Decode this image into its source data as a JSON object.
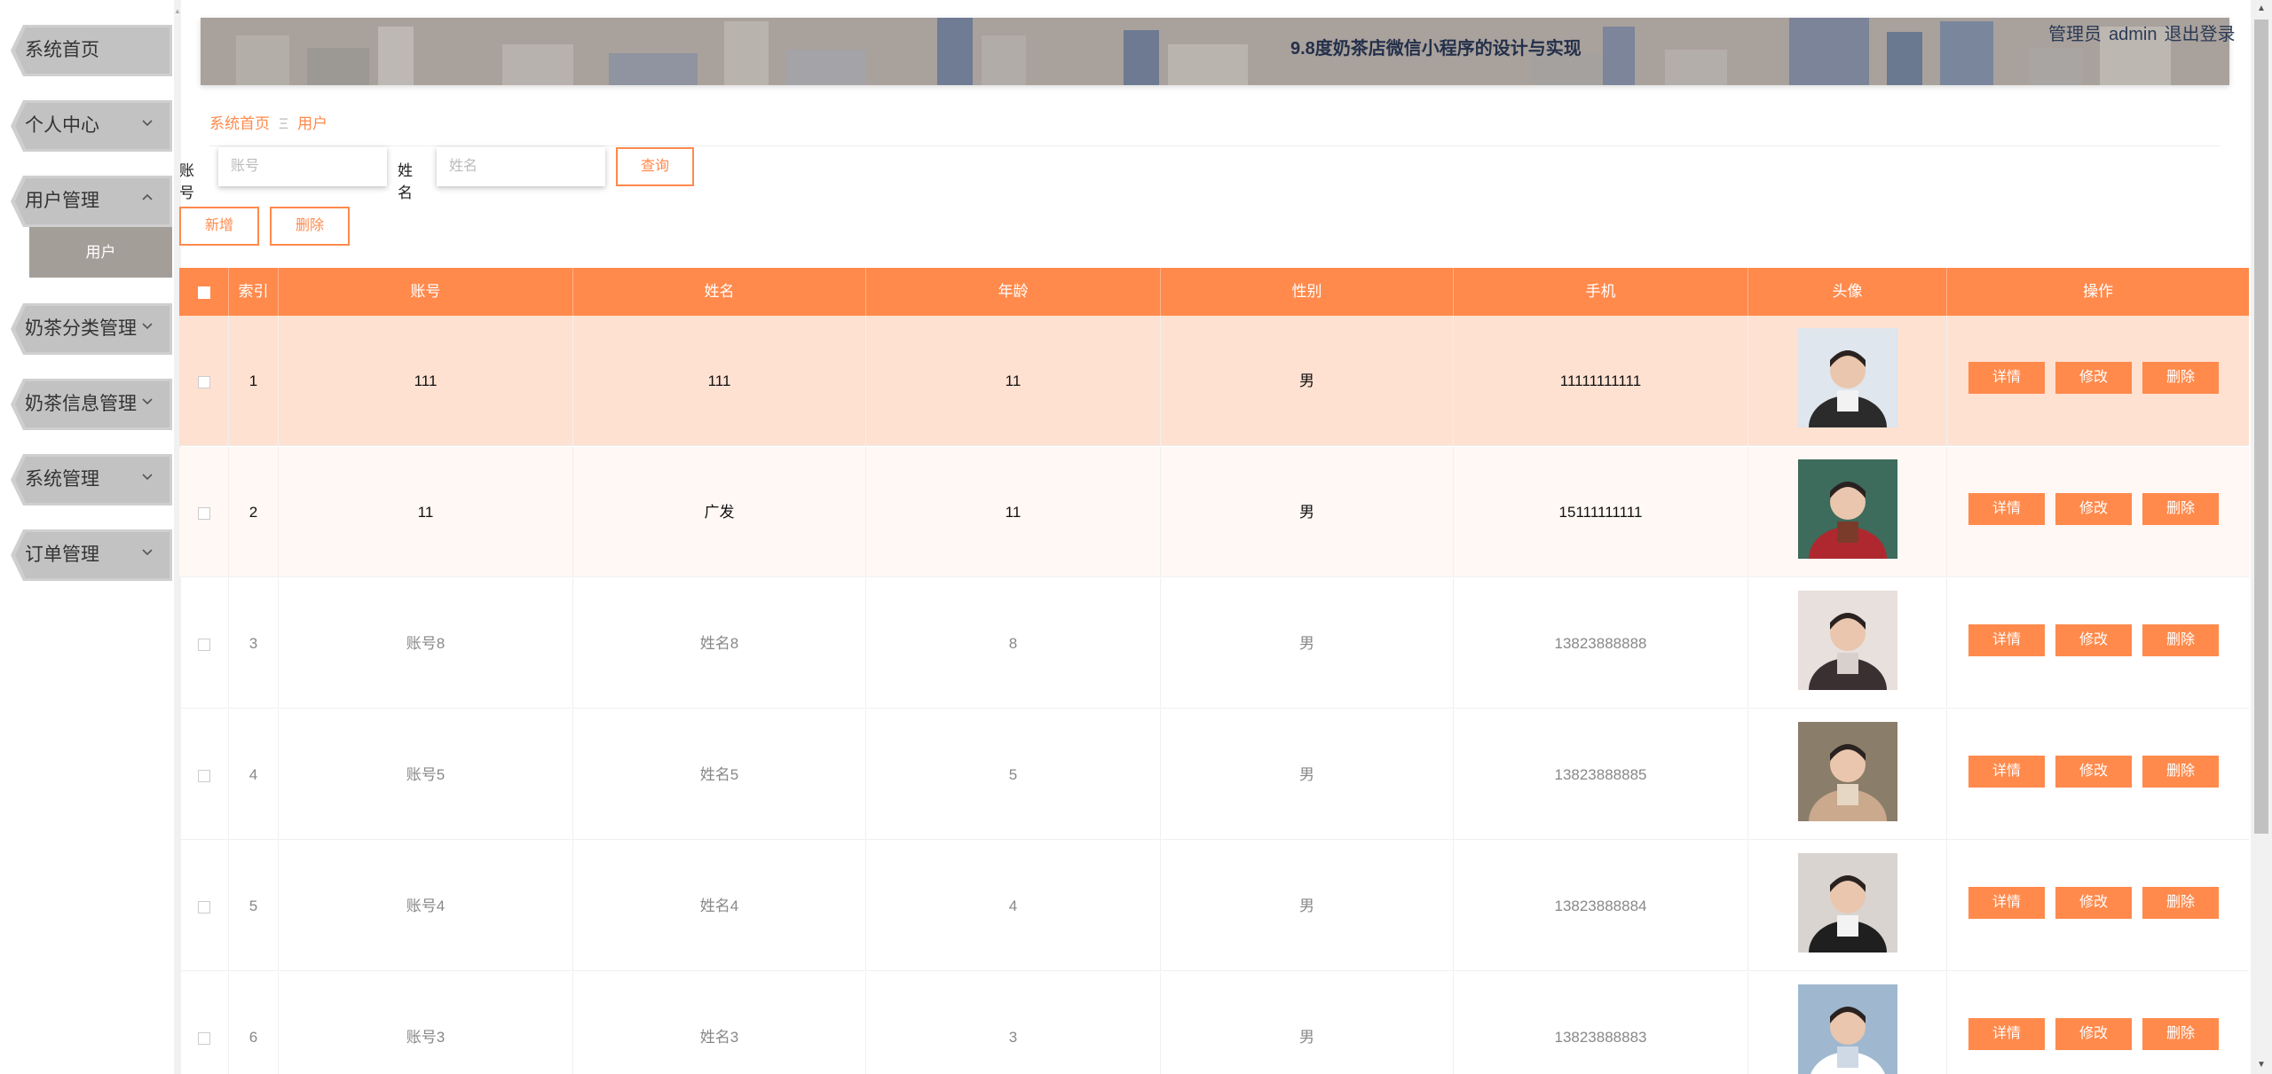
{
  "header": {
    "title": "9.8度奶茶店微信小程序的设计与实现",
    "user_role": "管理员",
    "username": "admin",
    "logout": "退出登录"
  },
  "sidebar": {
    "items": [
      {
        "label": "系统首页"
      },
      {
        "label": "个人中心"
      },
      {
        "label": "用户管理"
      },
      {
        "label": "奶茶分类管理"
      },
      {
        "label": "奶茶信息管理"
      },
      {
        "label": "系统管理"
      },
      {
        "label": "订单管理"
      }
    ],
    "submenu_active": "用户"
  },
  "breadcrumb": {
    "home": "系统首页",
    "separator": "Ξ",
    "current": "用户"
  },
  "search": {
    "account_label": "账号",
    "account_placeholder": "账号",
    "name_label": "姓名",
    "name_placeholder": "姓名",
    "query_button": "查询"
  },
  "toolbar": {
    "add_button": "新增",
    "delete_button": "删除"
  },
  "table": {
    "headers": [
      "索引",
      "账号",
      "姓名",
      "年龄",
      "性别",
      "手机",
      "头像",
      "操作"
    ],
    "actions": {
      "detail": "详情",
      "edit": "修改",
      "delete": "删除"
    },
    "rows": [
      {
        "index": "1",
        "account": "111",
        "name": "111",
        "age": "11",
        "gender": "男",
        "phone": "11111111111"
      },
      {
        "index": "2",
        "account": "11",
        "name": "广发",
        "age": "11",
        "gender": "男",
        "phone": "15111111111"
      },
      {
        "index": "3",
        "account": "账号8",
        "name": "姓名8",
        "age": "8",
        "gender": "男",
        "phone": "13823888888"
      },
      {
        "index": "4",
        "account": "账号5",
        "name": "姓名5",
        "age": "5",
        "gender": "男",
        "phone": "13823888885"
      },
      {
        "index": "5",
        "account": "账号4",
        "name": "姓名4",
        "age": "4",
        "gender": "男",
        "phone": "13823888884"
      },
      {
        "index": "6",
        "account": "账号3",
        "name": "姓名3",
        "age": "3",
        "gender": "男",
        "phone": "13823888883"
      }
    ]
  },
  "colors": {
    "accent": "#ff8a4c",
    "row_highlight": "#ffe1d1",
    "row_hover": "#fff8f4"
  }
}
